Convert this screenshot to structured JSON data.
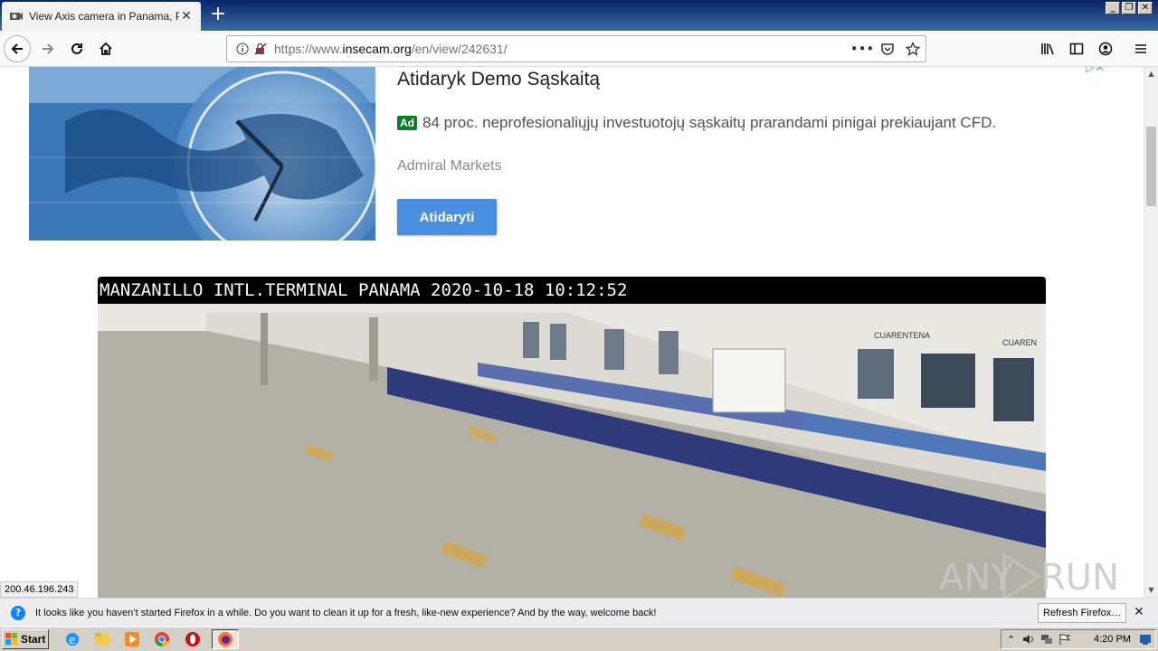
{
  "browser": {
    "tab": {
      "title": "View Axis camera in Panama, Panama",
      "close_glyph": "✕"
    },
    "new_tab_glyph": "+",
    "window_controls": [
      "_",
      "❐",
      "✕"
    ],
    "url": {
      "scheme": "https://www.",
      "host": "insecam.org",
      "path": "/en/view/242631/"
    },
    "url_actions": [
      "•••",
      "pocket",
      "star"
    ]
  },
  "ad": {
    "title": "Atidaryk Demo Sąskaitą",
    "badge": "Ad",
    "description": "84 proc. neprofesionaliųjų investuotojų sąskaitų prarandami pinigai prekiaujant CFD.",
    "advertiser": "Admiral Markets",
    "button_label": "Atidaryti",
    "adchoices_glyph": "▷✕"
  },
  "camera": {
    "overlay": "MANZANILLO INTL.TERMINAL PANAMA 2020-10-18 10:12:52",
    "signs": [
      "CUARENTENA",
      "CUAREN"
    ]
  },
  "status_tip": "200.46.196.243",
  "watermark": {
    "text": "ANY",
    "text2": "RUN"
  },
  "notification": {
    "message": "It looks like you haven’t started Firefox in a while. Do you want to clean it up for a fresh, like-new experience? And by the way, welcome back!",
    "button": "Refresh Firefox…",
    "close_glyph": "✕"
  },
  "taskbar": {
    "start_label": "Start",
    "clock": "4:20 PM",
    "tray_expander": "⌃"
  },
  "colors": {
    "accent": "#4a8ee0",
    "ad_badge": "#0d7d2a",
    "titlebar": "#0a246a"
  }
}
